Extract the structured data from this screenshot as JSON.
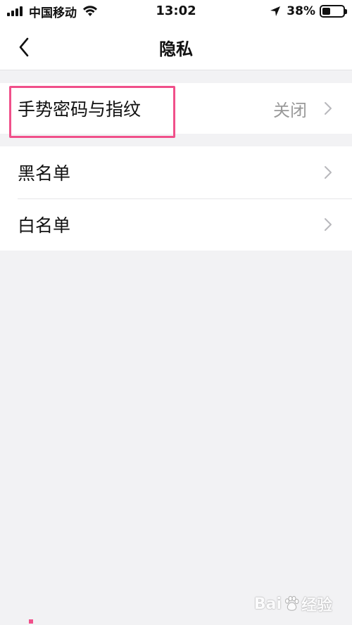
{
  "status_bar": {
    "carrier": "中国移动",
    "time": "13:02",
    "battery": "38%",
    "battery_level": 0.38
  },
  "nav": {
    "title": "隐私"
  },
  "settings": {
    "gesture": {
      "label": "手势密码与指纹",
      "value": "关闭"
    },
    "blacklist": {
      "label": "黑名单"
    },
    "whitelist": {
      "label": "白名单"
    }
  },
  "highlight_color": "#f0508a",
  "watermark": {
    "left": "Bai",
    "right": "经验"
  }
}
